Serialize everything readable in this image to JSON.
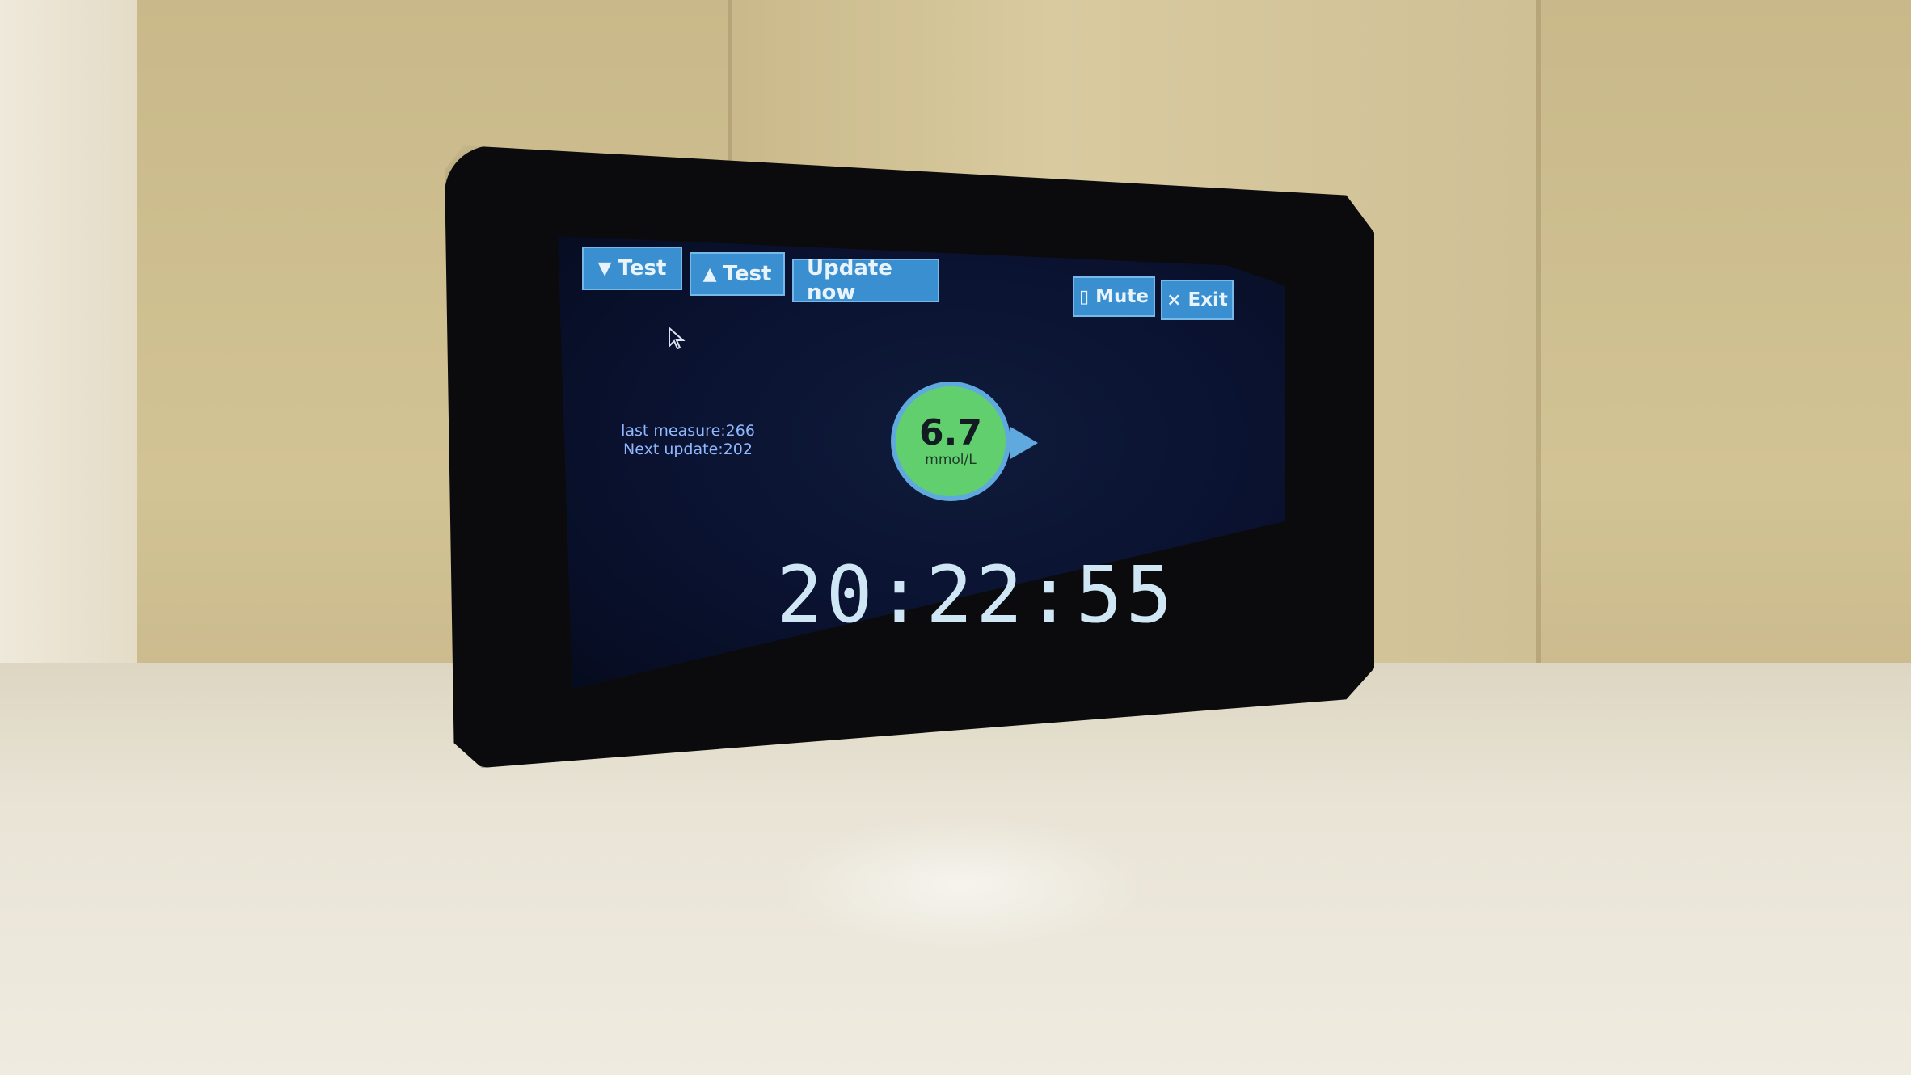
{
  "toolbar": {
    "down_test": {
      "glyph": "▼",
      "label": "Test"
    },
    "up_test": {
      "glyph": "▲",
      "label": "Test"
    },
    "update_now": "Update now",
    "mute": {
      "glyph": "▯",
      "label": "Mute"
    },
    "exit": {
      "glyph": "×",
      "label": "Exit"
    }
  },
  "status": {
    "last_measure": "last measure:266",
    "next_update": "Next update:202"
  },
  "glucose": {
    "value": "6.7",
    "unit": "mmol/L",
    "trend": "rising",
    "ring_color": "#5fa9de",
    "fill_color": "#62cf6e"
  },
  "clock": "20:22:55",
  "icons": {
    "down_arrow": "triangle-down-icon",
    "up_arrow": "triangle-up-icon",
    "mute": "mute-icon",
    "exit": "close-icon",
    "cursor": "mouse-cursor-icon"
  }
}
